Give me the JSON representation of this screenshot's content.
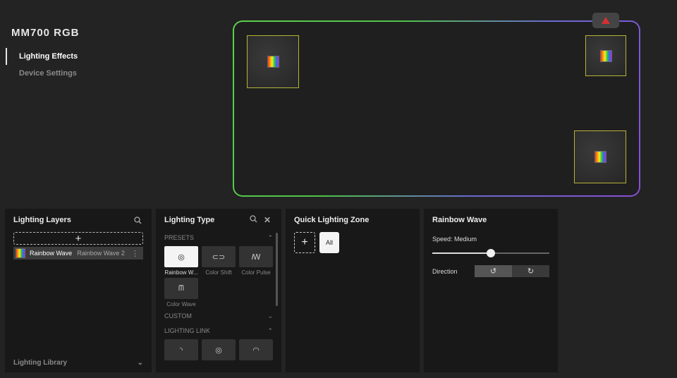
{
  "device": {
    "title": "MM700 RGB"
  },
  "nav": {
    "items": [
      {
        "label": "Lighting Effects",
        "active": true
      },
      {
        "label": "Device Settings",
        "active": false
      }
    ]
  },
  "pad": {
    "zones": [
      "rainbow-wave",
      "rainbow-wave",
      "rainbow-wave"
    ]
  },
  "lighting_layers": {
    "title": "Lighting Layers",
    "add_label": "+",
    "layer": {
      "name": "Rainbow Wave",
      "sub": "Rainbow Wave 2",
      "more": "⋮"
    },
    "footer": "Lighting Library"
  },
  "lighting_type": {
    "title": "Lighting Type",
    "presets_header": "PRESETS",
    "custom_header": "CUSTOM",
    "link_header": "LIGHTING LINK",
    "presets": [
      {
        "label": "Rainbow W...",
        "glyph": "◎"
      },
      {
        "label": "Color Shift",
        "glyph": "⊂⊃"
      },
      {
        "label": "Color Pulse",
        "glyph": "ꟿ"
      },
      {
        "label": "Color Wave",
        "glyph": "ᗰ"
      }
    ],
    "link_items": [
      "◝",
      "◎",
      "◠"
    ]
  },
  "quick_zone": {
    "title": "Quick Lighting Zone",
    "add_label": "+",
    "all_label": "All"
  },
  "rainbow_wave": {
    "title": "Rainbow Wave",
    "speed_label": "Speed: Medium",
    "speed_value": 0.5,
    "direction_label": "Direction",
    "dir_left": "↺",
    "dir_right": "↻"
  },
  "colors": {
    "pad_green": "#5cd14a",
    "pad_purple": "#8a4cd8",
    "zone_border": "#b7b33a"
  }
}
